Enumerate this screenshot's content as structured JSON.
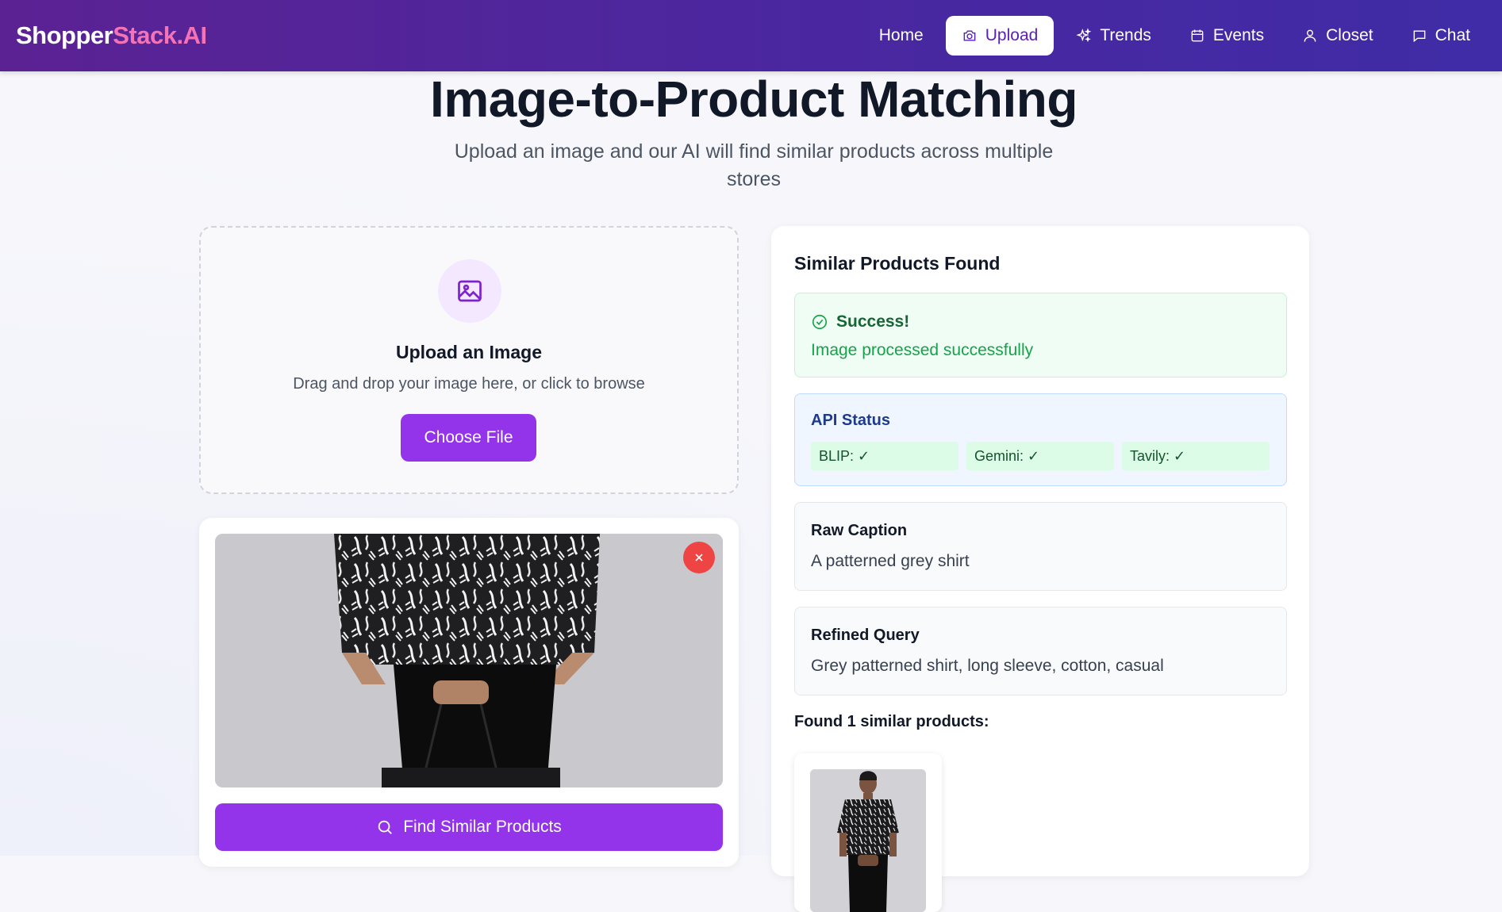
{
  "brand": {
    "part1": "Shopper",
    "part2": "Stack.AI"
  },
  "nav": {
    "home": "Home",
    "upload": "Upload",
    "trends": "Trends",
    "events": "Events",
    "closet": "Closet",
    "chat": "Chat"
  },
  "hero": {
    "title": "Image-to-Product Matching",
    "subtitle": "Upload an image and our AI will find similar products across multiple stores"
  },
  "upload": {
    "title": "Upload an Image",
    "instructions": "Drag and drop your image here, or click to browse",
    "choose_button": "Choose File"
  },
  "preview": {
    "find_button": "Find Similar Products"
  },
  "results": {
    "title": "Similar Products Found",
    "success_title": "Success!",
    "success_message": "Image processed successfully",
    "api_status_title": "API Status",
    "api_status": [
      {
        "label": "BLIP: ✓"
      },
      {
        "label": "Gemini: ✓"
      },
      {
        "label": "Tavily: ✓"
      }
    ],
    "raw_caption_title": "Raw Caption",
    "raw_caption": "A patterned grey shirt",
    "refined_query_title": "Refined Query",
    "refined_query": "Grey patterned shirt, long sleeve, cotton, casual",
    "found_label": "Found 1 similar products:"
  },
  "colors": {
    "accent": "#9333ea",
    "nav_gradient_start": "#5b2293",
    "nav_gradient_end": "#3f2ca6",
    "brand_highlight": "#f472b6",
    "success": "#16a34a",
    "danger": "#ef4444"
  },
  "icons": {
    "upload_nav": "camera-icon",
    "trends_nav": "sparkles-icon",
    "events_nav": "calendar-icon",
    "closet_nav": "user-icon",
    "chat_nav": "chat-bubble-icon",
    "dropzone": "image-icon",
    "remove": "close-icon",
    "find": "search-icon",
    "success": "check-circle-icon"
  }
}
